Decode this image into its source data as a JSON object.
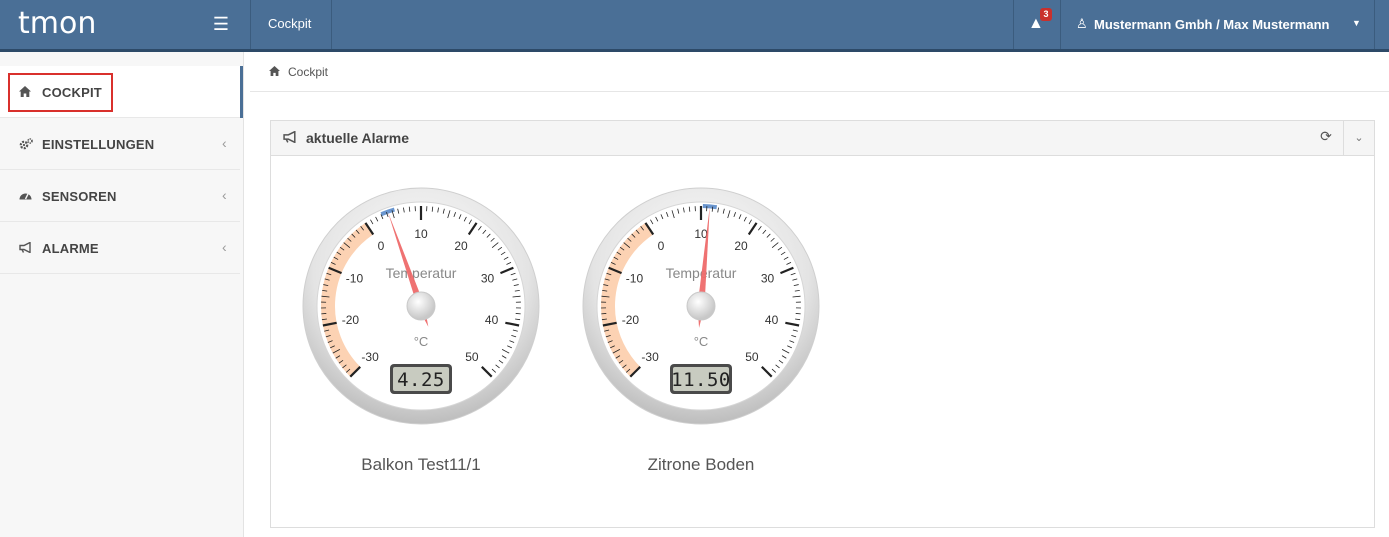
{
  "header": {
    "logo": "tmon",
    "menu_icon": "hamburger-icon",
    "title": "Cockpit",
    "alerts_count": "3",
    "user_label": "Mustermann Gmbh / Max Mustermann"
  },
  "sidebar": {
    "items": [
      {
        "label": "COCKPIT",
        "icon": "home-icon",
        "active": true
      },
      {
        "label": "EINSTELLUNGEN",
        "icon": "gears-icon",
        "active": false
      },
      {
        "label": "SENSOREN",
        "icon": "dashboard-icon",
        "active": false
      },
      {
        "label": "ALARME",
        "icon": "bullhorn-icon",
        "active": false
      }
    ]
  },
  "breadcrumb": {
    "label": "Cockpit"
  },
  "panel": {
    "title": "aktuelle Alarme",
    "gauges": [
      {
        "name": "Balkon Test11/1",
        "value": 4.25,
        "display": "4.25",
        "title": "Temperatur",
        "unit": "°C"
      },
      {
        "name": "Zitrone Boden",
        "value": 11.5,
        "display": "11.50",
        "title": "Temperatur",
        "unit": "°C"
      }
    ],
    "gauge_scale": {
      "min": -30,
      "max": 50,
      "major_ticks": [
        "-30",
        "-20",
        "-10",
        "0",
        "10",
        "20",
        "30",
        "40",
        "50"
      ]
    }
  },
  "colors": {
    "topbar": "#4a6f96",
    "highlight": "#d9302c",
    "gauge_band": "#fcd2b3",
    "needle": "#ee6a6a"
  }
}
